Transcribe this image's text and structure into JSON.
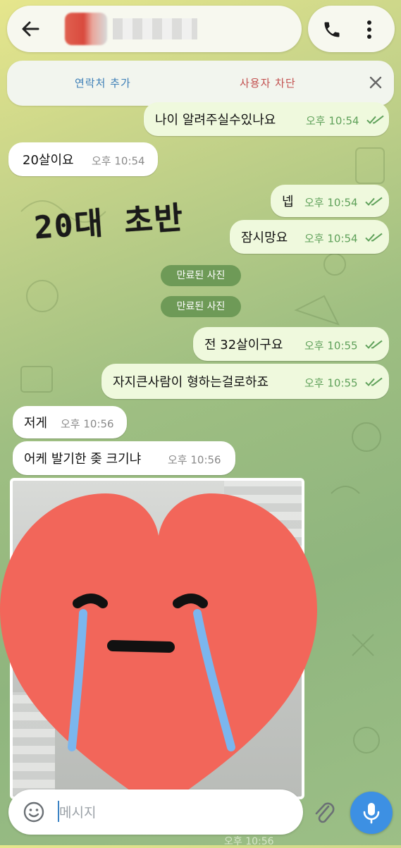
{
  "header": {
    "back_icon": "arrow-left-icon",
    "call_icon": "phone-icon",
    "more_icon": "more-vertical-icon"
  },
  "banner": {
    "add_contact": "연락처 추가",
    "block_user": "사용자 차단",
    "close_icon": "close-icon"
  },
  "messages": [
    {
      "side": "out",
      "text": "나이 알려주실수있나요",
      "time": "오후 10:54",
      "read": true
    },
    {
      "side": "in",
      "text": "20살이요",
      "time": "오후 10:54"
    },
    {
      "side": "out",
      "text": "넵",
      "time": "오후 10:54",
      "read": true
    },
    {
      "side": "out",
      "text": "잠시망요",
      "time": "오후 10:54",
      "read": true
    },
    {
      "side": "in",
      "text": "전 32살이구요",
      "time": "오후 10:55",
      "read": true
    },
    {
      "side": "out",
      "text": "자지큰사람이 형하는걸로하죠",
      "time": "오후 10:55",
      "read": true
    },
    {
      "side": "in",
      "text": "저게",
      "time": "오후 10:56"
    },
    {
      "side": "in",
      "text": "어케 발기한 좆 크기냐",
      "time": "오후 10:56"
    }
  ],
  "expired": [
    "만료된 사진",
    "만료된 사진"
  ],
  "overlay_caption": "20대 초반",
  "composer": {
    "placeholder": "메시지",
    "emoji_icon": "emoji-icon",
    "attach_icon": "paperclip-icon",
    "mic_icon": "microphone-icon"
  },
  "photo_time": "오후 10:56",
  "colors": {
    "incoming_bubble": "#ffffff",
    "outgoing_bubble": "#eff9dd",
    "time_outgoing": "#5fa15a",
    "mic_button": "#3d90e3",
    "heart": "#f2665a",
    "tears": "#7bb6ee"
  }
}
